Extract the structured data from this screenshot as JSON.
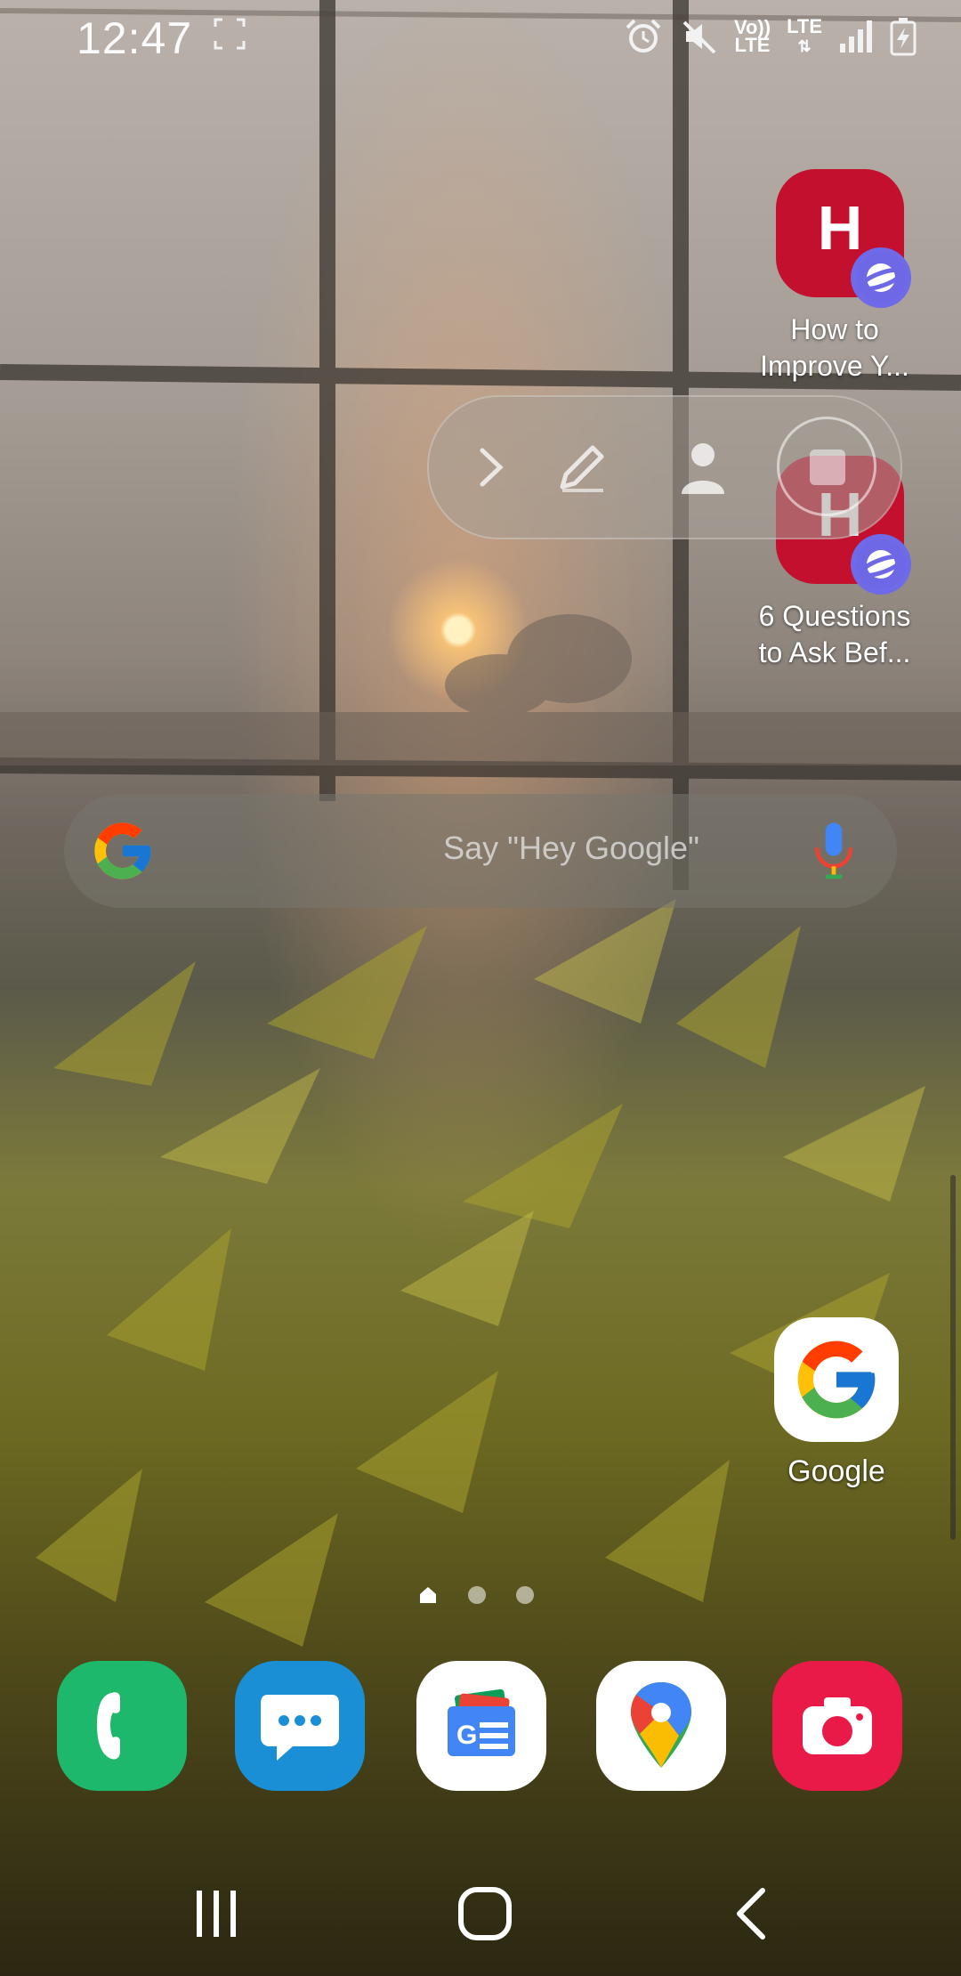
{
  "status_bar": {
    "time": "12:47",
    "icons": [
      "screenshot-scan-icon",
      "alarm-icon",
      "mute-icon",
      "volte-icon",
      "lte-data-icon",
      "signal-icon",
      "battery-charging-icon"
    ],
    "volte_top": "Vo))",
    "volte_bottom": "LTE",
    "lte_label": "LTE"
  },
  "shortcuts": [
    {
      "letter": "H",
      "label_line1": "How to",
      "label_line2": "Improve Y...",
      "badge_icon": "samsung-internet-icon",
      "color": "#c2102e"
    },
    {
      "letter": "H",
      "label_line1": "6 Questions",
      "label_line2": "to Ask Bef...",
      "badge_icon": "samsung-internet-icon",
      "color": "#c2102e"
    }
  ],
  "recorder_toolbar": {
    "buttons": [
      "expand-chevron-icon",
      "draw-pen-icon",
      "selfie-person-icon",
      "stop-record-icon"
    ]
  },
  "search": {
    "placeholder": "Say \"Hey Google\"",
    "left_icon": "google-g-icon",
    "right_icon": "microphone-icon"
  },
  "home_apps": [
    {
      "label": "Google",
      "icon": "google-g-icon"
    }
  ],
  "pager": {
    "pages": 3,
    "current": 1
  },
  "dock": [
    {
      "name": "phone",
      "icon": "phone-icon",
      "color": "#1db86b"
    },
    {
      "name": "messages",
      "icon": "messages-icon",
      "color": "#1a8fd6"
    },
    {
      "name": "google-news",
      "icon": "google-news-icon",
      "color": "#ffffff"
    },
    {
      "name": "maps",
      "icon": "google-maps-icon",
      "color": "#ffffff"
    },
    {
      "name": "screen-recorder",
      "icon": "camera-icon",
      "color": "#e91a47"
    }
  ],
  "nav": [
    "recents-icon",
    "home-icon",
    "back-icon"
  ]
}
